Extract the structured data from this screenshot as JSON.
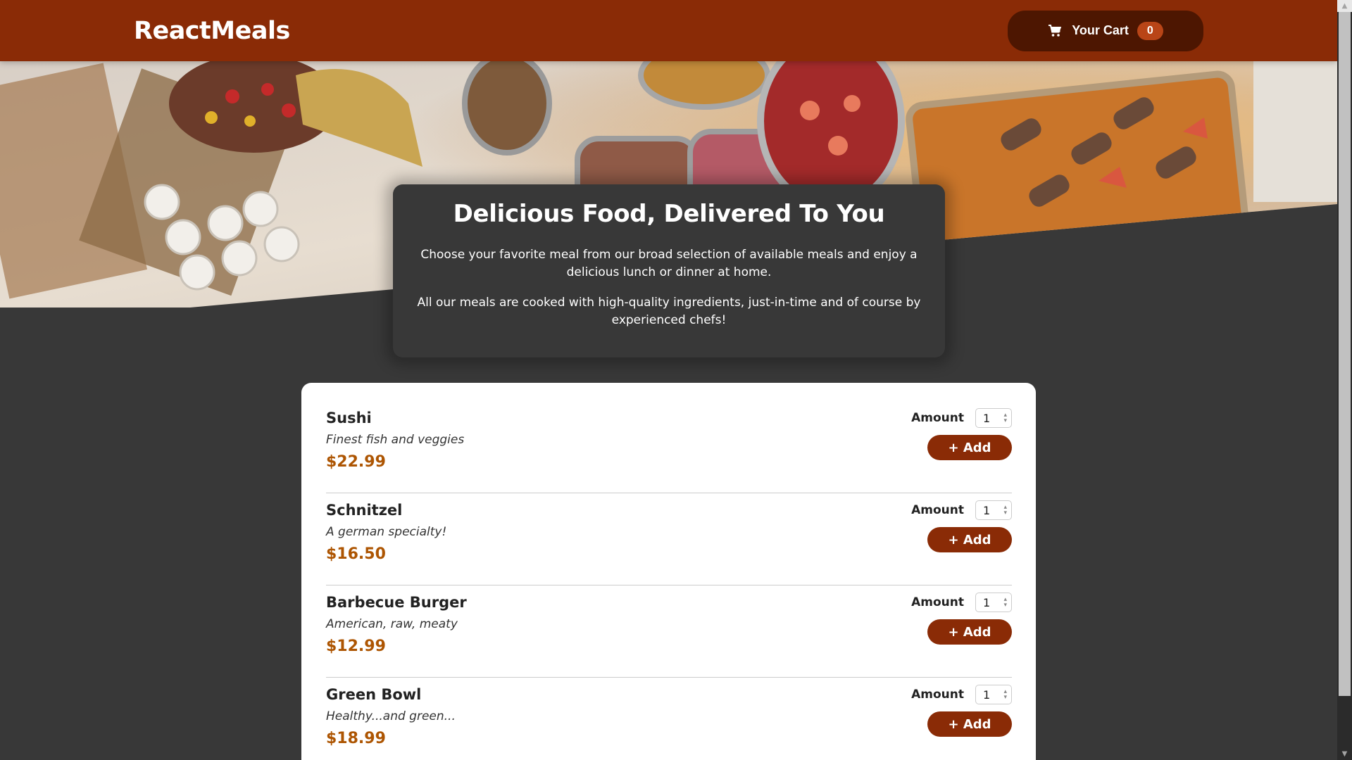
{
  "header": {
    "brand": "ReactMeals",
    "cart_label": "Your Cart",
    "cart_count": "0"
  },
  "summary": {
    "title": "Delicious Food, Delivered To You",
    "paragraph1": "Choose your favorite meal from our broad selection of available meals and enjoy a delicious lunch or dinner at home.",
    "paragraph2": "All our meals are cooked with high-quality ingredients, just-in-time and of course by experienced chefs!"
  },
  "meals": {
    "amount_label": "Amount",
    "add_label": "+ Add",
    "items": [
      {
        "name": "Sushi",
        "description": "Finest fish and veggies",
        "price": "$22.99",
        "amount": "1"
      },
      {
        "name": "Schnitzel",
        "description": "A german specialty!",
        "price": "$16.50",
        "amount": "1"
      },
      {
        "name": "Barbecue Burger",
        "description": "American, raw, meaty",
        "price": "$12.99",
        "amount": "1"
      },
      {
        "name": "Green Bowl",
        "description": "Healthy...and green...",
        "price": "$18.99",
        "amount": "1"
      }
    ]
  },
  "colors": {
    "header": "#8a2b06",
    "cart_button": "#4d1601",
    "badge": "#b94517",
    "page_bg": "#383838",
    "price": "#ad5502"
  },
  "icons": {
    "cart": "cart-icon",
    "scroll_up": "chevron-up-icon",
    "scroll_down": "chevron-down-icon"
  }
}
